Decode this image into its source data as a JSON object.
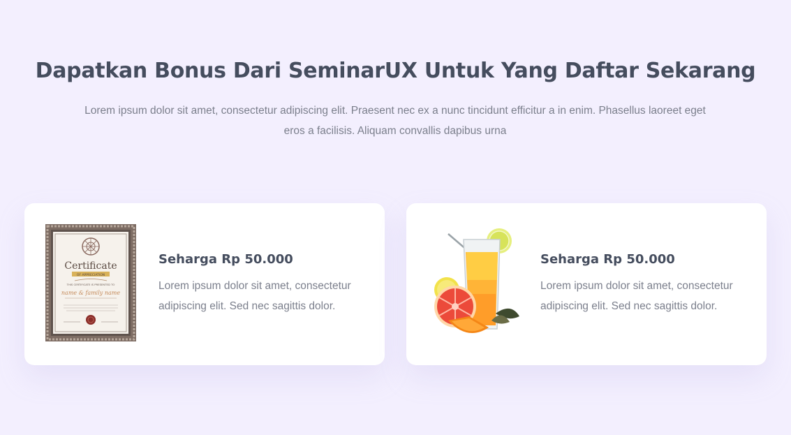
{
  "section": {
    "headline": "Dapatkan Bonus Dari SeminarUX Untuk Yang Daftar Sekarang",
    "subtext": "Lorem ipsum dolor sit amet, consectetur adipiscing elit. Praesent nec ex a nunc tincidunt efficitur a in enim. Phasellus laoreet eget eros a facilisis. Aliquam convallis dapibus urna"
  },
  "cards": [
    {
      "image": "certificate-image",
      "image_text": {
        "title": "Certificate",
        "ribbon": "OF APPRECIATION",
        "line": "THIS CERTIFICATE IS PRESENTED TO",
        "name": "name & family name"
      },
      "title": "Seharga Rp 50.000",
      "description": "Lorem ipsum dolor sit amet, consectetur adipiscing elit. Sed nec sagittis dolor."
    },
    {
      "image": "fruit-juice-image",
      "title": "Seharga Rp 50.000",
      "description": "Lorem ipsum dolor sit amet, consectetur adipiscing elit. Sed nec sagittis dolor."
    }
  ],
  "colors": {
    "background": "#f3effe",
    "card": "#ffffff",
    "heading": "#454d5e",
    "body_text": "#7b7f8c"
  }
}
